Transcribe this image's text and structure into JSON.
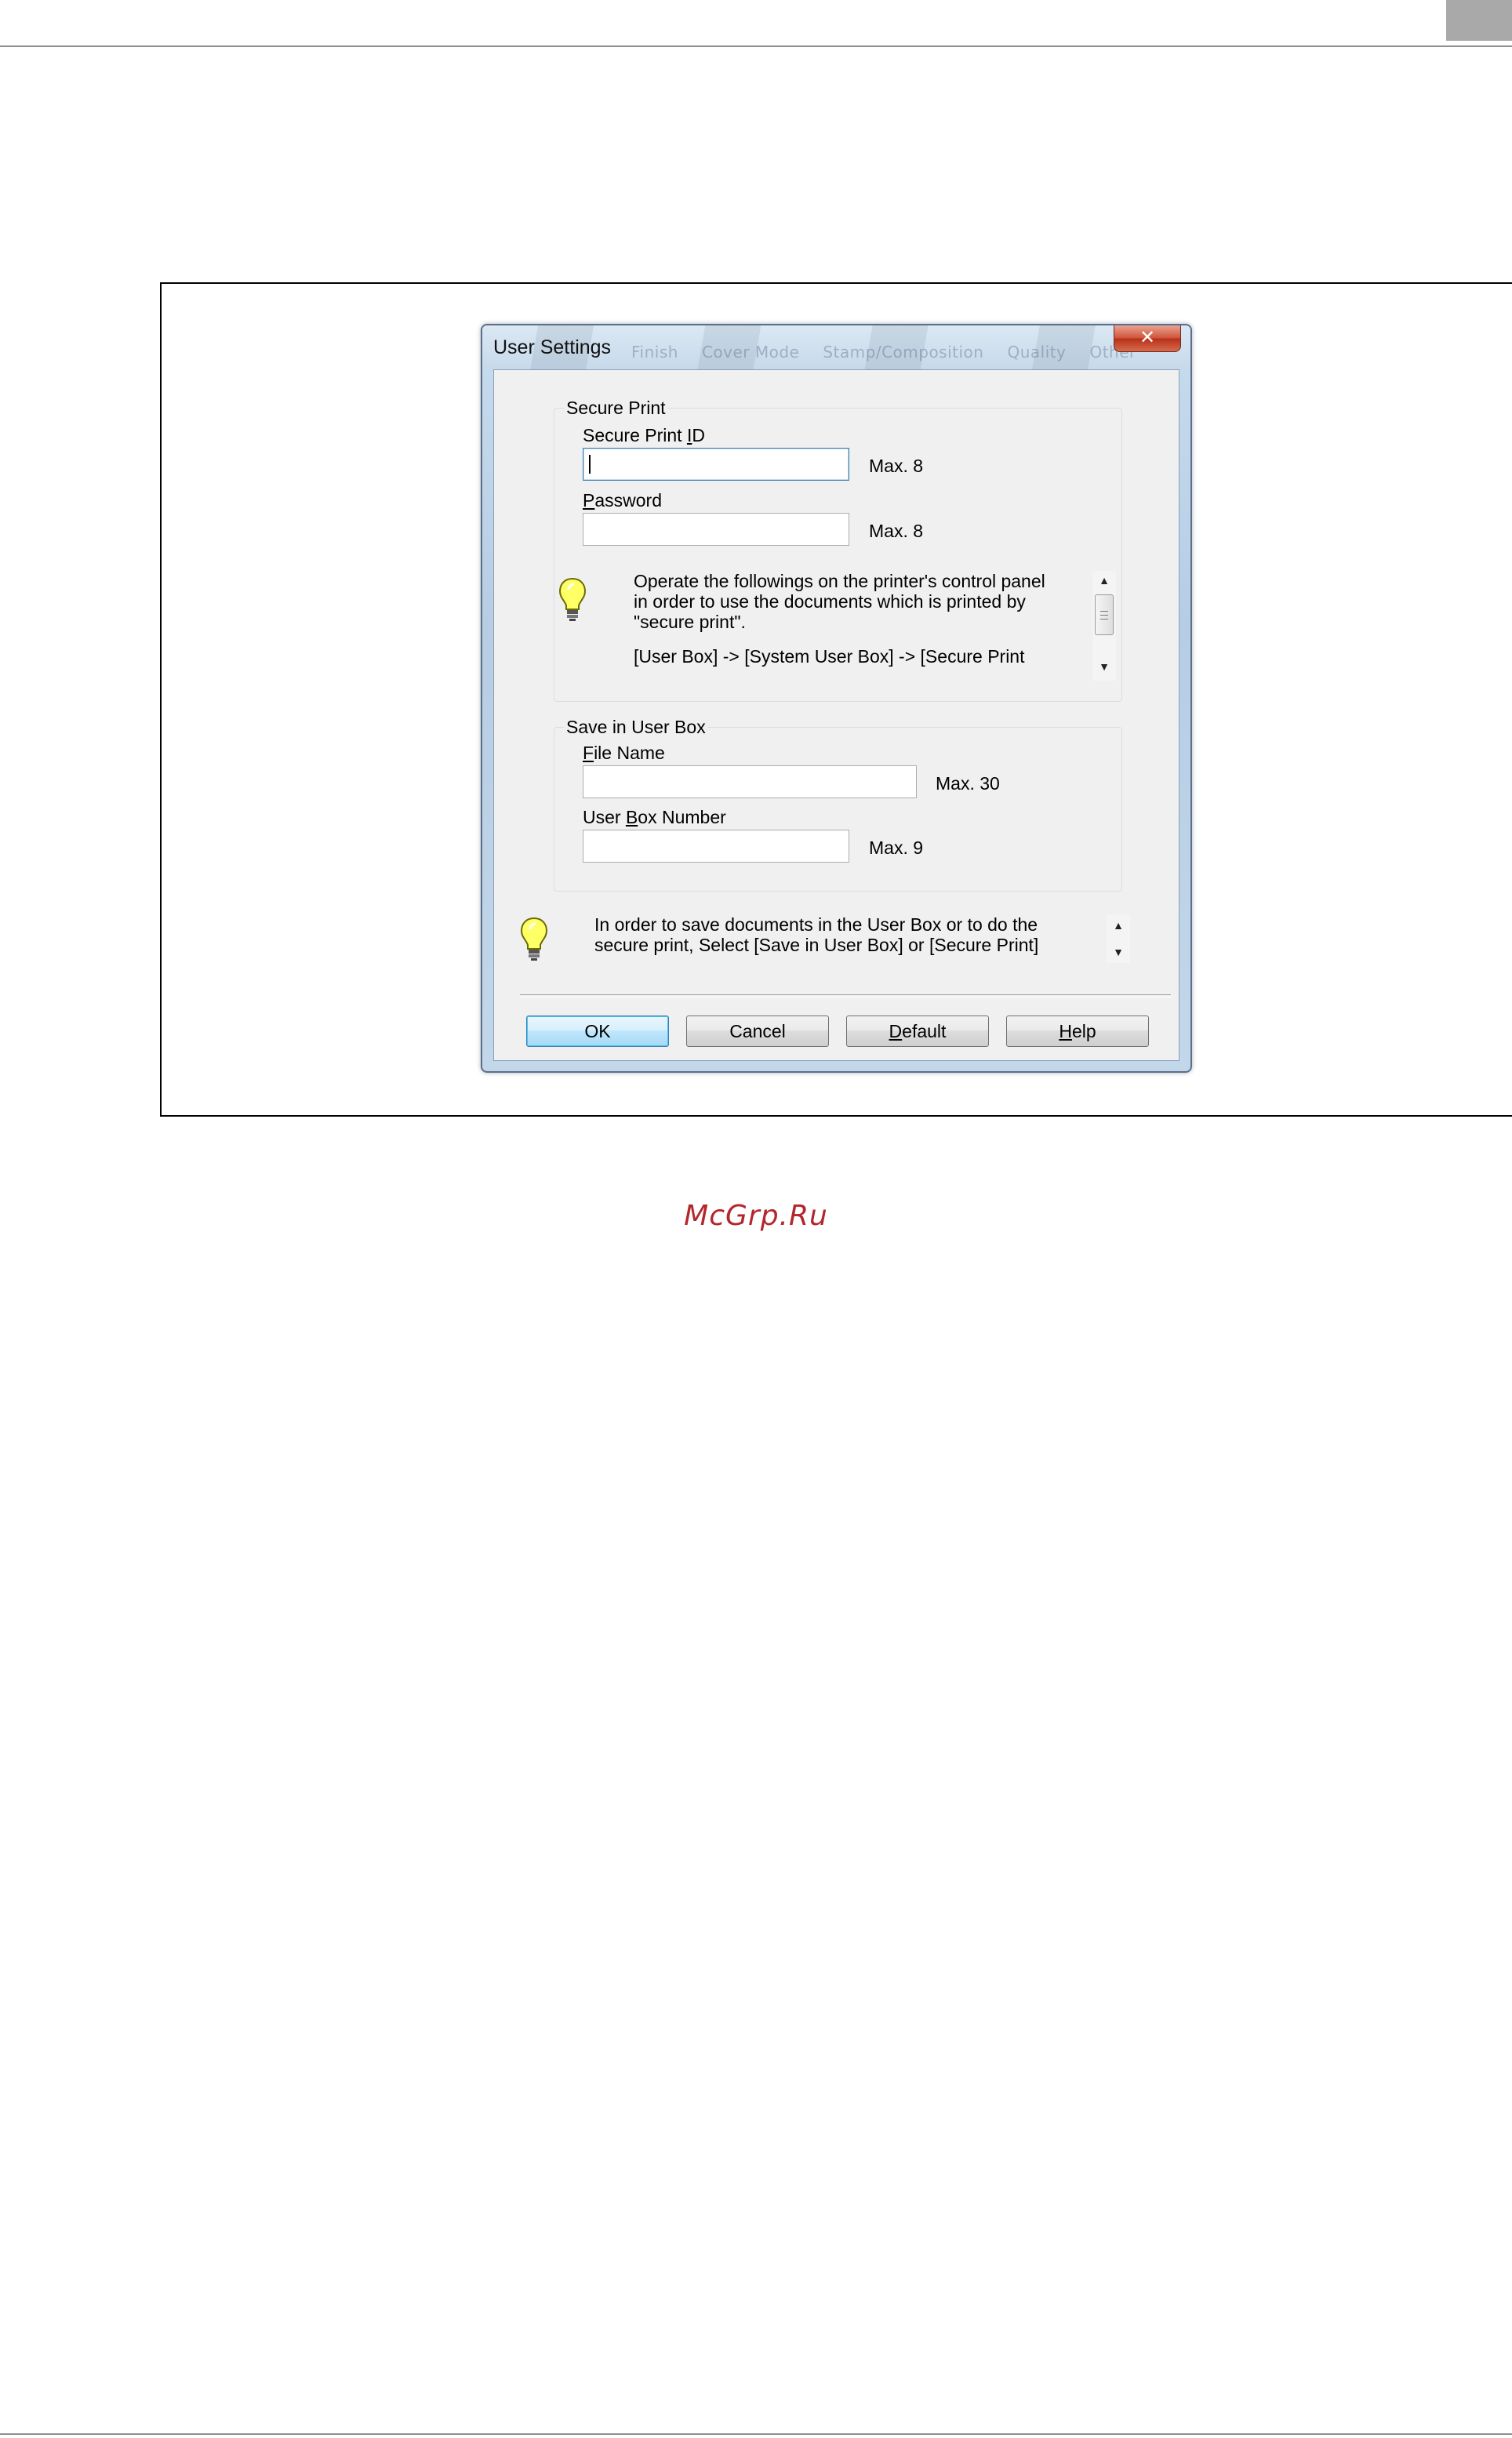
{
  "dialog": {
    "title": "User Settings",
    "close_glyph": "✕",
    "background_tabs": [
      "Finish",
      "Cover Mode",
      "Stamp/Composition",
      "Quality",
      "Other"
    ]
  },
  "secure_print": {
    "legend": "Secure Print",
    "id_label_pre": "Secure Print ",
    "id_label_mn": "I",
    "id_label_post": "D",
    "id_value": "",
    "id_max": "Max. 8",
    "password_label_mn": "P",
    "password_label_post": "assword",
    "password_value": "",
    "password_max": "Max. 8",
    "note_line1": "Operate the followings on the printer's control panel",
    "note_line2": "in order to use the documents which is printed by",
    "note_line3": "\"secure print\".",
    "note_line4": "[User Box] -> [System User Box] -> [Secure Print"
  },
  "save_user_box": {
    "legend": "Save in User Box",
    "file_label_mn": "F",
    "file_label_post": "ile Name",
    "file_value": "",
    "file_max": "Max. 30",
    "box_label_pre": "User ",
    "box_label_mn": "B",
    "box_label_post": "ox Number",
    "box_value": "",
    "box_max": "Max. 9"
  },
  "bottom_note": {
    "line1": "In order to save documents in the User Box or to do the",
    "line2": "secure print, Select [Save in User Box] or [Secure Print]"
  },
  "buttons": {
    "ok": "OK",
    "cancel": "Cancel",
    "default_mn": "D",
    "default_post": "efault",
    "help_mn": "H",
    "help_post": "elp"
  },
  "watermark": "McGrp.Ru",
  "colors": {
    "watermark": "#b3262c",
    "default_button_border": "#3c7fb1"
  },
  "icons": {
    "hint": "lightbulb-icon",
    "close": "close-icon"
  }
}
